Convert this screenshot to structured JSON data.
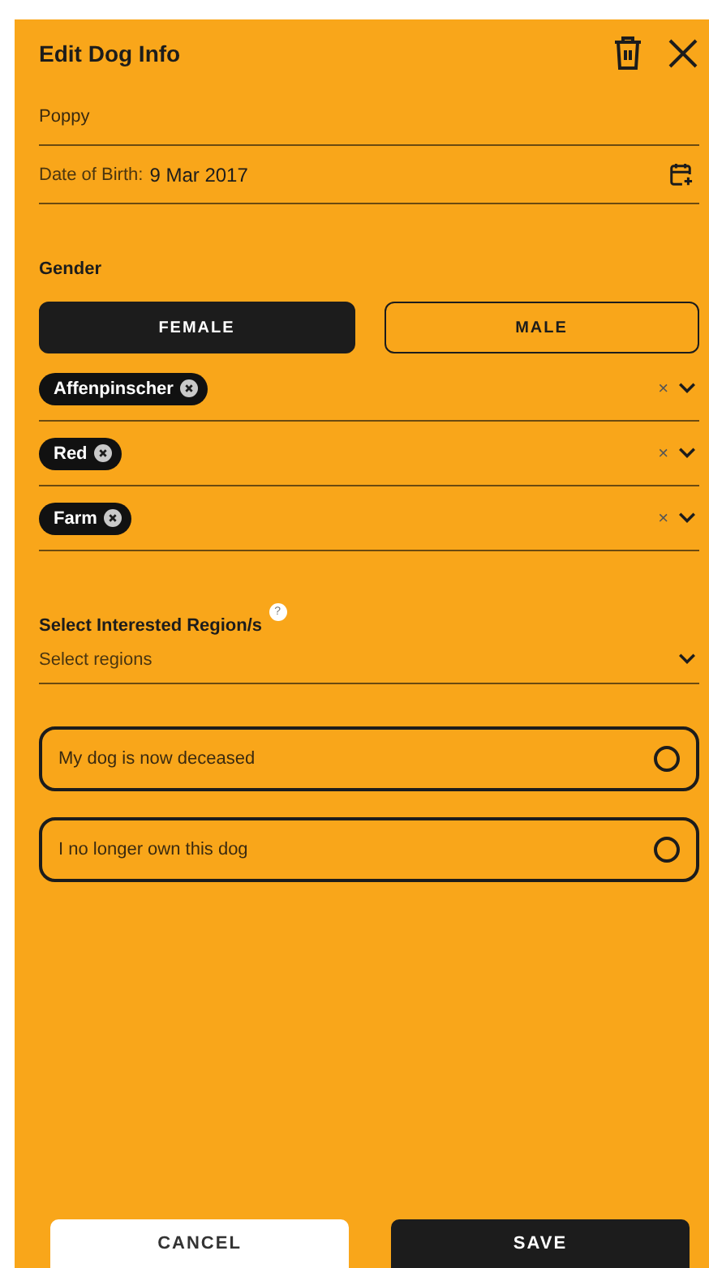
{
  "header": {
    "title": "Edit Dog Info"
  },
  "name_field": {
    "value": "Poppy"
  },
  "dob_field": {
    "label": "Date of Birth:",
    "value": "9 Mar 2017"
  },
  "gender": {
    "label": "Gender",
    "options": [
      {
        "label": "FEMALE",
        "selected": true
      },
      {
        "label": "MALE",
        "selected": false
      }
    ]
  },
  "selects": [
    {
      "tags": [
        "Affenpinscher"
      ],
      "clear": "×"
    },
    {
      "tags": [
        "Red"
      ],
      "clear": "×"
    },
    {
      "tags": [
        "Farm"
      ],
      "clear": "×"
    }
  ],
  "regions": {
    "label": "Select Interested Region/s",
    "help": "?",
    "placeholder": "Select regions"
  },
  "status_options": [
    {
      "label": "My dog is now deceased",
      "checked": false
    },
    {
      "label": "I no longer own this dog",
      "checked": false
    }
  ],
  "footer": {
    "cancel": "CANCEL",
    "save": "SAVE"
  }
}
